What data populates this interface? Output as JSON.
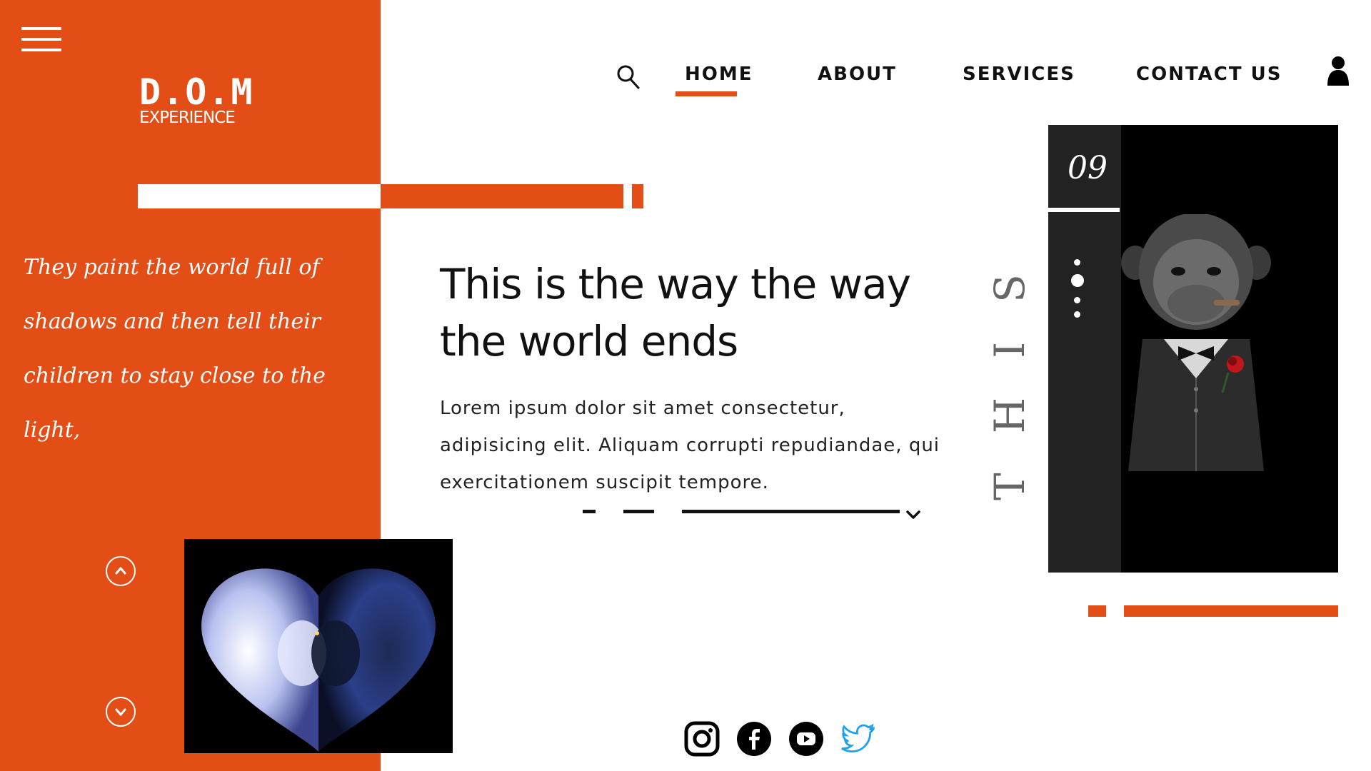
{
  "brand": {
    "logo_main": "D.O.M",
    "logo_sub": "EXPERIENCE",
    "accent_color": "#e24e15"
  },
  "nav": {
    "items": [
      {
        "label": "HOME",
        "active": true
      },
      {
        "label": "ABOUT",
        "active": false
      },
      {
        "label": "SERVICES",
        "active": false
      },
      {
        "label": "CONTACT US",
        "active": false
      }
    ],
    "icons": [
      "menu-icon",
      "search-icon",
      "user-icon"
    ]
  },
  "quote": {
    "text": "They paint the world full of shadows and then tell their children to stay close to the light,"
  },
  "hero": {
    "headline": "This is the way the way the world ends",
    "body": "Lorem ipsum dolor sit amet consectetur, adipisicing elit. Aliquam corrupti repudiandae, qui exercitationem suscipit tempore."
  },
  "card": {
    "number": "09",
    "vertical_word": "THIS"
  },
  "social": [
    "instagram-icon",
    "facebook-icon",
    "youtube-icon",
    "twitter-icon"
  ]
}
